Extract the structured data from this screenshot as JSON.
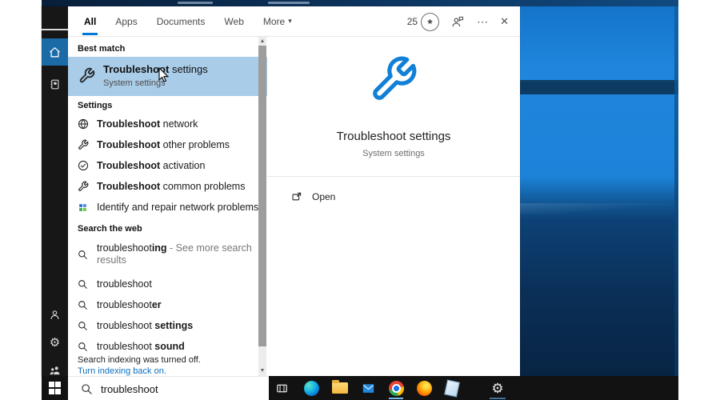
{
  "colors": {
    "accent": "#0078d7",
    "best_match_highlight": "#a9cce8",
    "sidebar_bg": "#171717",
    "sidebar_selected_bg": "#1b6ba6",
    "taskbar_bg": "#121212",
    "wallpaper_top": "#1e86dc",
    "wallpaper_bottom": "#082443",
    "link_blue": "#0b6fc2",
    "preview_icon_blue": "#1180d6"
  },
  "glyphs": {
    "chevron": "›",
    "caret_down": "▾",
    "ellipsis": "⋯",
    "close": "✕",
    "scroll_up": "▲",
    "scroll_down": "▼",
    "gear": "⚙"
  },
  "icons": {
    "sidebar": [
      "hamburger-icon",
      "home-icon",
      "journal-icon",
      "person-icon",
      "gear-icon",
      "feedback-icon"
    ],
    "header_right": [
      "rewards-medal-icon",
      "feedback-person-icon",
      "ellipsis-icon",
      "close-icon"
    ],
    "best_match": "wrench-icon",
    "settings_rows": [
      "globe-wrench-icon",
      "wrench-icon",
      "check-circle-icon",
      "wrench-icon",
      "network-repair-icon"
    ],
    "web_rows": "search-icon",
    "preview": [
      "wrench-icon-large",
      "open-window-icon"
    ],
    "taskbar": [
      "start-icon",
      "search-icon",
      "task-view-icon",
      "edge-icon",
      "file-explorer-icon",
      "mail-icon",
      "chrome-icon",
      "firefox-icon",
      "notepad-icon",
      "settings-gear-icon"
    ]
  },
  "tabs": [
    {
      "label": "All",
      "active": true
    },
    {
      "label": "Apps",
      "active": false
    },
    {
      "label": "Documents",
      "active": false
    },
    {
      "label": "Web",
      "active": false
    },
    {
      "label": "More",
      "active": false
    }
  ],
  "header_right": {
    "rewards_count": "25"
  },
  "best_match": {
    "header": "Best match",
    "title_bold": "Troubleshoot",
    "title_rest": " settings",
    "subtitle": "System settings"
  },
  "settings": {
    "header": "Settings",
    "items": [
      {
        "bold": "Troubleshoot",
        "rest": " network"
      },
      {
        "bold": "Troubleshoot",
        "rest": " other problems"
      },
      {
        "bold": "Troubleshoot",
        "rest": " activation"
      },
      {
        "bold": "Troubleshoot",
        "rest": " common problems"
      },
      {
        "bold": "",
        "rest": "Identify and repair network problems"
      }
    ]
  },
  "web": {
    "header": "Search the web",
    "items": [
      {
        "base": "troubleshoot",
        "bold": "ing",
        "suffix": " - See more search results"
      },
      {
        "base": "troubleshoot",
        "bold": "",
        "suffix": ""
      },
      {
        "base": "troubleshoot",
        "bold": "er",
        "suffix": ""
      },
      {
        "base": "troubleshoot ",
        "bold": "settings",
        "suffix": ""
      },
      {
        "base": "troubleshoot ",
        "bold": "sound",
        "suffix": ""
      }
    ]
  },
  "indexing": {
    "notice": "Search indexing was turned off.",
    "link": "Turn indexing back on."
  },
  "preview": {
    "title": "Troubleshoot settings",
    "subtitle": "System settings",
    "open_label": "Open"
  },
  "taskbar": {
    "search_value": "troubleshoot"
  }
}
